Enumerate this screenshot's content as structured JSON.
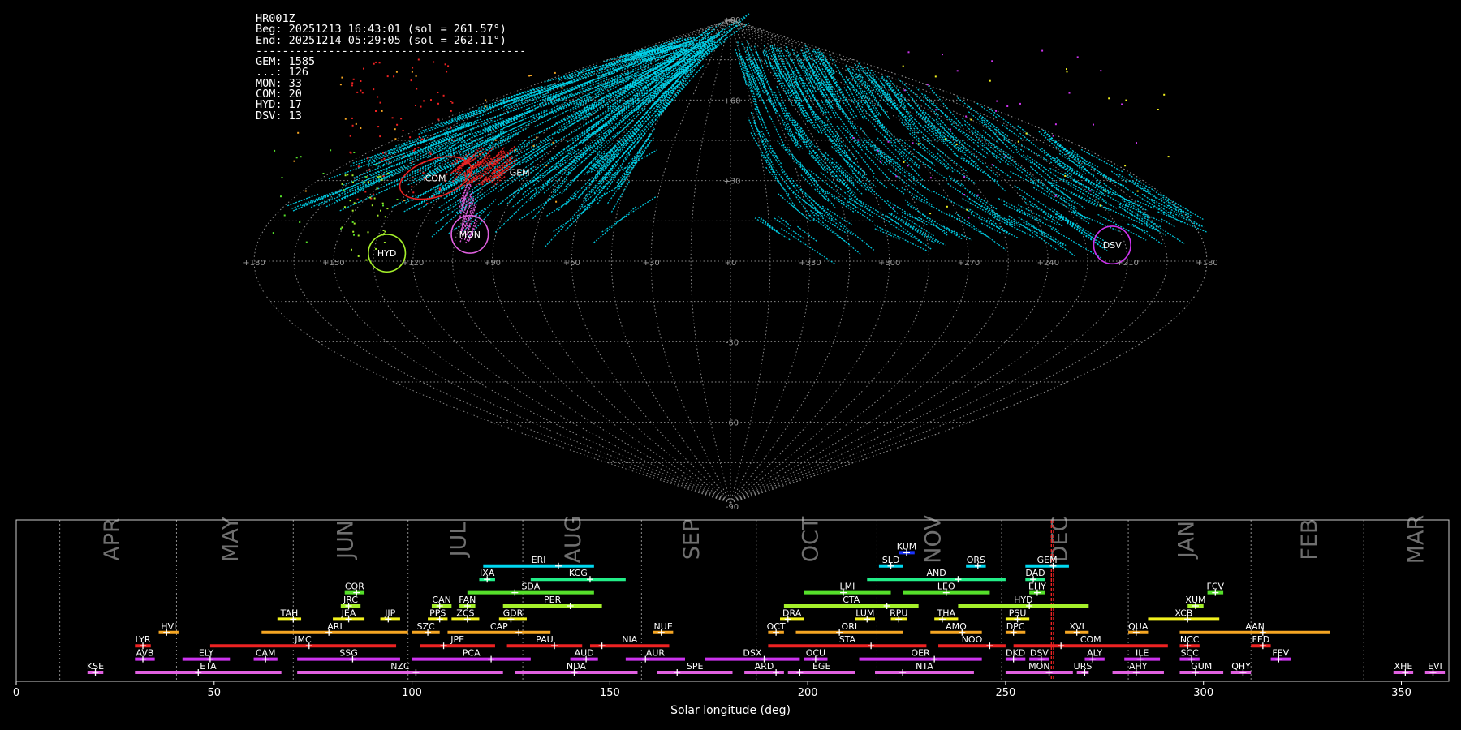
{
  "info": {
    "id": "HR001Z",
    "beg": "Beg: 20251213 16:43:01 (sol = 261.57°)",
    "end": "End: 20251214 05:29:05 (sol = 262.11°)",
    "sep": "-----------------------------------------",
    "counts": [
      "GEM: 1585",
      "...: 126",
      "MON: 33",
      "COM: 20",
      "HYD: 17",
      "DSV: 13"
    ]
  },
  "colors": {
    "cyan": "#00d8f0",
    "red": "#ee2222",
    "orange": "#f5a623",
    "yellow": "#f2f21e",
    "lime": "#a5f02a",
    "green": "#55e02a",
    "mint": "#22ee88",
    "magenta": "#cc33ee",
    "pink": "#e060e0",
    "blue": "#1a33ff",
    "grid": "#8a8a8a"
  },
  "chart_data": [
    {
      "type": "scatter",
      "projection": "sinusoidal (all-sky)",
      "lon_ticks": [
        "+180",
        "+150",
        "+120",
        "+90",
        "+60",
        "+30",
        "+0",
        "+330",
        "+300",
        "+270",
        "+240",
        "+210",
        "+180"
      ],
      "lat_ticks": [
        "+90",
        "+60",
        "+30",
        "-30",
        "-60",
        "-90"
      ],
      "showers": [
        {
          "code": "COM",
          "lon": 130,
          "lat": 31,
          "color": "red",
          "r": [
            14,
            7
          ]
        },
        {
          "code": "GEM",
          "lon": 95,
          "lat": 33,
          "color": "red",
          "r": [
            0,
            0
          ]
        },
        {
          "code": "HYD",
          "lon": 130,
          "lat": 3,
          "color": "lime",
          "r": [
            7,
            7
          ]
        },
        {
          "code": "MON",
          "lon": 100,
          "lat": 10,
          "color": "pink",
          "r": [
            7,
            7
          ]
        },
        {
          "code": "DSV",
          "lon": 215,
          "lat": 6,
          "color": "magenta",
          "r": [
            7,
            7
          ]
        }
      ]
    },
    {
      "type": "bar",
      "title": "",
      "xlabel": "Solar longitude (deg)",
      "ylabel": "",
      "xlim": [
        0,
        362
      ],
      "x_ticks": [
        0,
        50,
        100,
        150,
        200,
        250,
        300,
        350
      ],
      "months": [
        {
          "name": "APR",
          "center": 24.5,
          "end": 40.5
        },
        {
          "name": "MAY",
          "center": 54.5,
          "end": 70
        },
        {
          "name": "JUN",
          "center": 83.5,
          "end": 99
        },
        {
          "name": "JUL",
          "center": 112,
          "end": 128
        },
        {
          "name": "AUG",
          "center": 141,
          "end": 158
        },
        {
          "name": "SEP",
          "center": 171,
          "end": 187
        },
        {
          "name": "OCT",
          "center": 201,
          "end": 217.5
        },
        {
          "name": "NOV",
          "center": 232,
          "end": 249
        },
        {
          "name": "DEC",
          "center": 264,
          "end": 281
        },
        {
          "name": "JAN",
          "center": 296,
          "end": 312
        },
        {
          "name": "FEB",
          "center": 327,
          "end": 340.5
        },
        {
          "name": "MAR",
          "center": 354,
          "end": 11
        }
      ],
      "current_sol": [
        261.57,
        262.11
      ],
      "showers": [
        {
          "code": "KUM",
          "start": 223,
          "end": 227,
          "peak": 225,
          "row": 10,
          "color": "blue"
        },
        {
          "code": "ERI",
          "start": 118,
          "end": 146,
          "peak": 137,
          "row": 9,
          "color": "cyan"
        },
        {
          "code": "SLD",
          "start": 218,
          "end": 224,
          "peak": 221,
          "row": 9,
          "color": "cyan"
        },
        {
          "code": "ORS",
          "start": 240,
          "end": 245,
          "peak": 243,
          "row": 9,
          "color": "cyan"
        },
        {
          "code": "GEM",
          "start": 255,
          "end": 266,
          "peak": 262,
          "row": 9,
          "color": "cyan"
        },
        {
          "code": "IXA",
          "start": 117,
          "end": 121,
          "peak": 119,
          "row": 8,
          "color": "mint"
        },
        {
          "code": "KCG",
          "start": 130,
          "end": 154,
          "peak": 145,
          "row": 8,
          "color": "mint"
        },
        {
          "code": "AND",
          "start": 215,
          "end": 250,
          "peak": 238,
          "row": 8,
          "color": "mint"
        },
        {
          "code": "DAD",
          "start": 255,
          "end": 260,
          "peak": 257,
          "row": 8,
          "color": "mint"
        },
        {
          "code": "COR",
          "start": 83,
          "end": 88,
          "peak": 86,
          "row": 7,
          "color": "green"
        },
        {
          "code": "SDA",
          "start": 114,
          "end": 146,
          "peak": 126,
          "row": 7,
          "color": "green"
        },
        {
          "code": "LMI",
          "start": 199,
          "end": 221,
          "peak": 209,
          "row": 7,
          "color": "green"
        },
        {
          "code": "LEO",
          "start": 224,
          "end": 246,
          "peak": 235,
          "row": 7,
          "color": "green"
        },
        {
          "code": "EHY",
          "start": 256,
          "end": 260,
          "peak": 258,
          "row": 7,
          "color": "green"
        },
        {
          "code": "FCV",
          "start": 301,
          "end": 305,
          "peak": 303,
          "row": 7,
          "color": "green"
        },
        {
          "code": "JRC",
          "start": 82,
          "end": 87,
          "peak": 84,
          "row": 6,
          "color": "lime"
        },
        {
          "code": "CAN",
          "start": 105,
          "end": 110,
          "peak": 107,
          "row": 6,
          "color": "lime"
        },
        {
          "code": "FAN",
          "start": 112,
          "end": 116,
          "peak": 114,
          "row": 6,
          "color": "lime"
        },
        {
          "code": "PER",
          "start": 123,
          "end": 148,
          "peak": 140,
          "row": 6,
          "color": "lime"
        },
        {
          "code": "CTA",
          "start": 194,
          "end": 228,
          "peak": 220,
          "row": 6,
          "color": "lime"
        },
        {
          "code": "HYD",
          "start": 238,
          "end": 271,
          "peak": 256,
          "row": 6,
          "color": "lime"
        },
        {
          "code": "XUM",
          "start": 296,
          "end": 300,
          "peak": 298,
          "row": 6,
          "color": "lime"
        },
        {
          "code": "TAH",
          "start": 66,
          "end": 72,
          "peak": 70,
          "row": 5,
          "color": "yellow"
        },
        {
          "code": "JEA",
          "start": 80,
          "end": 88,
          "peak": 84,
          "row": 5,
          "color": "yellow"
        },
        {
          "code": "JIP",
          "start": 92,
          "end": 97,
          "peak": 94,
          "row": 5,
          "color": "yellow"
        },
        {
          "code": "PPS",
          "start": 104,
          "end": 109,
          "peak": 107,
          "row": 5,
          "color": "yellow"
        },
        {
          "code": "ZCS",
          "start": 110,
          "end": 117,
          "peak": 114,
          "row": 5,
          "color": "yellow"
        },
        {
          "code": "GDR",
          "start": 122,
          "end": 129,
          "peak": 125,
          "row": 5,
          "color": "yellow"
        },
        {
          "code": "DRA",
          "start": 193,
          "end": 199,
          "peak": 195,
          "row": 5,
          "color": "yellow"
        },
        {
          "code": "LUM",
          "start": 212,
          "end": 217,
          "peak": 215,
          "row": 5,
          "color": "yellow"
        },
        {
          "code": "RPU",
          "start": 221,
          "end": 225,
          "peak": 223,
          "row": 5,
          "color": "yellow"
        },
        {
          "code": "THA",
          "start": 232,
          "end": 238,
          "peak": 234,
          "row": 5,
          "color": "yellow"
        },
        {
          "code": "PSU",
          "start": 250,
          "end": 256,
          "peak": 253,
          "row": 5,
          "color": "yellow"
        },
        {
          "code": "XCB",
          "start": 286,
          "end": 304,
          "peak": 296,
          "row": 5,
          "color": "yellow"
        },
        {
          "code": "HVI",
          "start": 36,
          "end": 41,
          "peak": 38,
          "row": 4,
          "color": "orange"
        },
        {
          "code": "ARI",
          "start": 62,
          "end": 99,
          "peak": 79,
          "row": 4,
          "color": "orange"
        },
        {
          "code": "SZC",
          "start": 100,
          "end": 107,
          "peak": 104,
          "row": 4,
          "color": "orange"
        },
        {
          "code": "CAP",
          "start": 109,
          "end": 135,
          "peak": 127,
          "row": 4,
          "color": "orange"
        },
        {
          "code": "NUE",
          "start": 161,
          "end": 166,
          "peak": 163,
          "row": 4,
          "color": "orange"
        },
        {
          "code": "OCT",
          "start": 190,
          "end": 194,
          "peak": 192,
          "row": 4,
          "color": "orange"
        },
        {
          "code": "ORI",
          "start": 197,
          "end": 224,
          "peak": 208,
          "row": 4,
          "color": "orange"
        },
        {
          "code": "AMO",
          "start": 231,
          "end": 244,
          "peak": 239,
          "row": 4,
          "color": "orange"
        },
        {
          "code": "DPC",
          "start": 250,
          "end": 255,
          "peak": 252,
          "row": 4,
          "color": "orange"
        },
        {
          "code": "XVI",
          "start": 265,
          "end": 271,
          "peak": 268,
          "row": 4,
          "color": "orange"
        },
        {
          "code": "QUA",
          "start": 281,
          "end": 286,
          "peak": 283,
          "row": 4,
          "color": "orange"
        },
        {
          "code": "AAN",
          "start": 294,
          "end": 332,
          "peak": 315,
          "row": 4,
          "color": "orange"
        },
        {
          "code": "LYR",
          "start": 30,
          "end": 34,
          "peak": 32,
          "row": 3,
          "color": "red"
        },
        {
          "code": "JMC",
          "start": 49,
          "end": 96,
          "peak": 74,
          "row": 3,
          "color": "red"
        },
        {
          "code": "JPE",
          "start": 102,
          "end": 121,
          "peak": 108,
          "row": 3,
          "color": "red"
        },
        {
          "code": "PAU",
          "start": 124,
          "end": 143,
          "peak": 136,
          "row": 3,
          "color": "red"
        },
        {
          "code": "NIA",
          "start": 145,
          "end": 165,
          "peak": 148,
          "row": 3,
          "color": "red"
        },
        {
          "code": "STA",
          "start": 190,
          "end": 230,
          "peak": 216,
          "row": 3,
          "color": "red"
        },
        {
          "code": "NOO",
          "start": 233,
          "end": 250,
          "peak": 246,
          "row": 3,
          "color": "red"
        },
        {
          "code": "COM",
          "start": 252,
          "end": 291,
          "peak": 264,
          "row": 3,
          "color": "red"
        },
        {
          "code": "NCC",
          "start": 294,
          "end": 299,
          "peak": 296,
          "row": 3,
          "color": "red"
        },
        {
          "code": "FED",
          "start": 312,
          "end": 317,
          "peak": 315,
          "row": 3,
          "color": "red"
        },
        {
          "code": "AVB",
          "start": 30,
          "end": 35,
          "peak": 32,
          "row": 2,
          "color": "magenta"
        },
        {
          "code": "ELY",
          "start": 42,
          "end": 54,
          "peak": 49,
          "row": 2,
          "color": "magenta"
        },
        {
          "code": "CAM",
          "start": 60,
          "end": 66,
          "peak": 63,
          "row": 2,
          "color": "magenta"
        },
        {
          "code": "SSG",
          "start": 71,
          "end": 97,
          "peak": 85,
          "row": 2,
          "color": "magenta"
        },
        {
          "code": "PCA",
          "start": 100,
          "end": 130,
          "peak": 120,
          "row": 2,
          "color": "magenta"
        },
        {
          "code": "AUD",
          "start": 140,
          "end": 147,
          "peak": 144,
          "row": 2,
          "color": "magenta"
        },
        {
          "code": "AUR",
          "start": 154,
          "end": 169,
          "peak": 159,
          "row": 2,
          "color": "magenta"
        },
        {
          "code": "DSX",
          "start": 174,
          "end": 198,
          "peak": 189,
          "row": 2,
          "color": "magenta"
        },
        {
          "code": "OCU",
          "start": 199,
          "end": 205,
          "peak": 202,
          "row": 2,
          "color": "magenta"
        },
        {
          "code": "OER",
          "start": 213,
          "end": 244,
          "peak": 232,
          "row": 2,
          "color": "magenta"
        },
        {
          "code": "DKD",
          "start": 250,
          "end": 255,
          "peak": 252,
          "row": 2,
          "color": "magenta"
        },
        {
          "code": "DSV",
          "start": 256,
          "end": 261,
          "peak": 259,
          "row": 2,
          "color": "magenta"
        },
        {
          "code": "ALY",
          "start": 270,
          "end": 275,
          "peak": 272,
          "row": 2,
          "color": "magenta"
        },
        {
          "code": "ILE",
          "start": 280,
          "end": 289,
          "peak": 284,
          "row": 2,
          "color": "magenta"
        },
        {
          "code": "SCC",
          "start": 294,
          "end": 299,
          "peak": 297,
          "row": 2,
          "color": "magenta"
        },
        {
          "code": "FEV",
          "start": 317,
          "end": 322,
          "peak": 319,
          "row": 2,
          "color": "magenta"
        },
        {
          "code": "KSE",
          "start": 18,
          "end": 22,
          "peak": 20,
          "row": 1,
          "color": "pink"
        },
        {
          "code": "ETA",
          "start": 30,
          "end": 67,
          "peak": 46,
          "row": 1,
          "color": "pink"
        },
        {
          "code": "NZC",
          "start": 71,
          "end": 123,
          "peak": 101,
          "row": 1,
          "color": "pink"
        },
        {
          "code": "NDA",
          "start": 126,
          "end": 157,
          "peak": 141,
          "row": 1,
          "color": "pink"
        },
        {
          "code": "SPE",
          "start": 162,
          "end": 181,
          "peak": 167,
          "row": 1,
          "color": "pink"
        },
        {
          "code": "ARD",
          "start": 184,
          "end": 194,
          "peak": 192,
          "row": 1,
          "color": "pink"
        },
        {
          "code": "EGE",
          "start": 195,
          "end": 212,
          "peak": 198,
          "row": 1,
          "color": "pink"
        },
        {
          "code": "NTA",
          "start": 217,
          "end": 242,
          "peak": 224,
          "row": 1,
          "color": "pink"
        },
        {
          "code": "MON",
          "start": 250,
          "end": 267,
          "peak": 261,
          "row": 1,
          "color": "pink"
        },
        {
          "code": "URS",
          "start": 268,
          "end": 271,
          "peak": 270,
          "row": 1,
          "color": "pink"
        },
        {
          "code": "AHY",
          "start": 277,
          "end": 290,
          "peak": 283,
          "row": 1,
          "color": "pink"
        },
        {
          "code": "GUM",
          "start": 294,
          "end": 305,
          "peak": 298,
          "row": 1,
          "color": "pink"
        },
        {
          "code": "QHY",
          "start": 307,
          "end": 312,
          "peak": 310,
          "row": 1,
          "color": "pink"
        },
        {
          "code": "XHE",
          "start": 348,
          "end": 353,
          "peak": 351,
          "row": 1,
          "color": "pink"
        },
        {
          "code": "EVI",
          "start": 356,
          "end": 361,
          "peak": 358,
          "row": 1,
          "color": "pink"
        }
      ]
    }
  ]
}
